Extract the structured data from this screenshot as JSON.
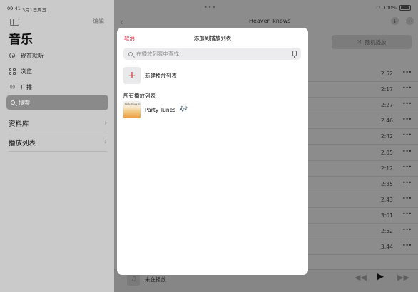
{
  "status_bar": {
    "time": "09:41",
    "date": "3月1日周五",
    "battery": "100%"
  },
  "sidebar": {
    "edit_label": "编辑",
    "title": "音乐",
    "items": [
      {
        "label": "现在就听",
        "icon": "play-circle-icon"
      },
      {
        "label": "浏览",
        "icon": "grid-icon"
      },
      {
        "label": "广播",
        "icon": "radio-waves-icon"
      }
    ],
    "search_label": "搜索",
    "sections": [
      {
        "label": "资料库"
      },
      {
        "label": "播放列表"
      }
    ]
  },
  "album": {
    "title": "Heaven knows",
    "shuffle_label": "随机播放",
    "durations": [
      "2:52",
      "2:17",
      "2:27",
      "2:46",
      "2:42",
      "2:05",
      "2:12",
      "2:35",
      "2:43",
      "3:01",
      "2:52",
      "3:44"
    ]
  },
  "player": {
    "now_playing": "未在播放"
  },
  "sheet": {
    "cancel_label": "取消",
    "title": "添加到播放列表",
    "search_placeholder": "在播放列表中查找",
    "new_playlist_label": "新建播放列表",
    "section_title": "所有播放列表",
    "playlists": [
      {
        "name": "Party Tunes",
        "art_caption": "Party Tunes 🎶",
        "emoji": "🎶"
      }
    ]
  },
  "colors": {
    "accent": "#e0243a"
  }
}
